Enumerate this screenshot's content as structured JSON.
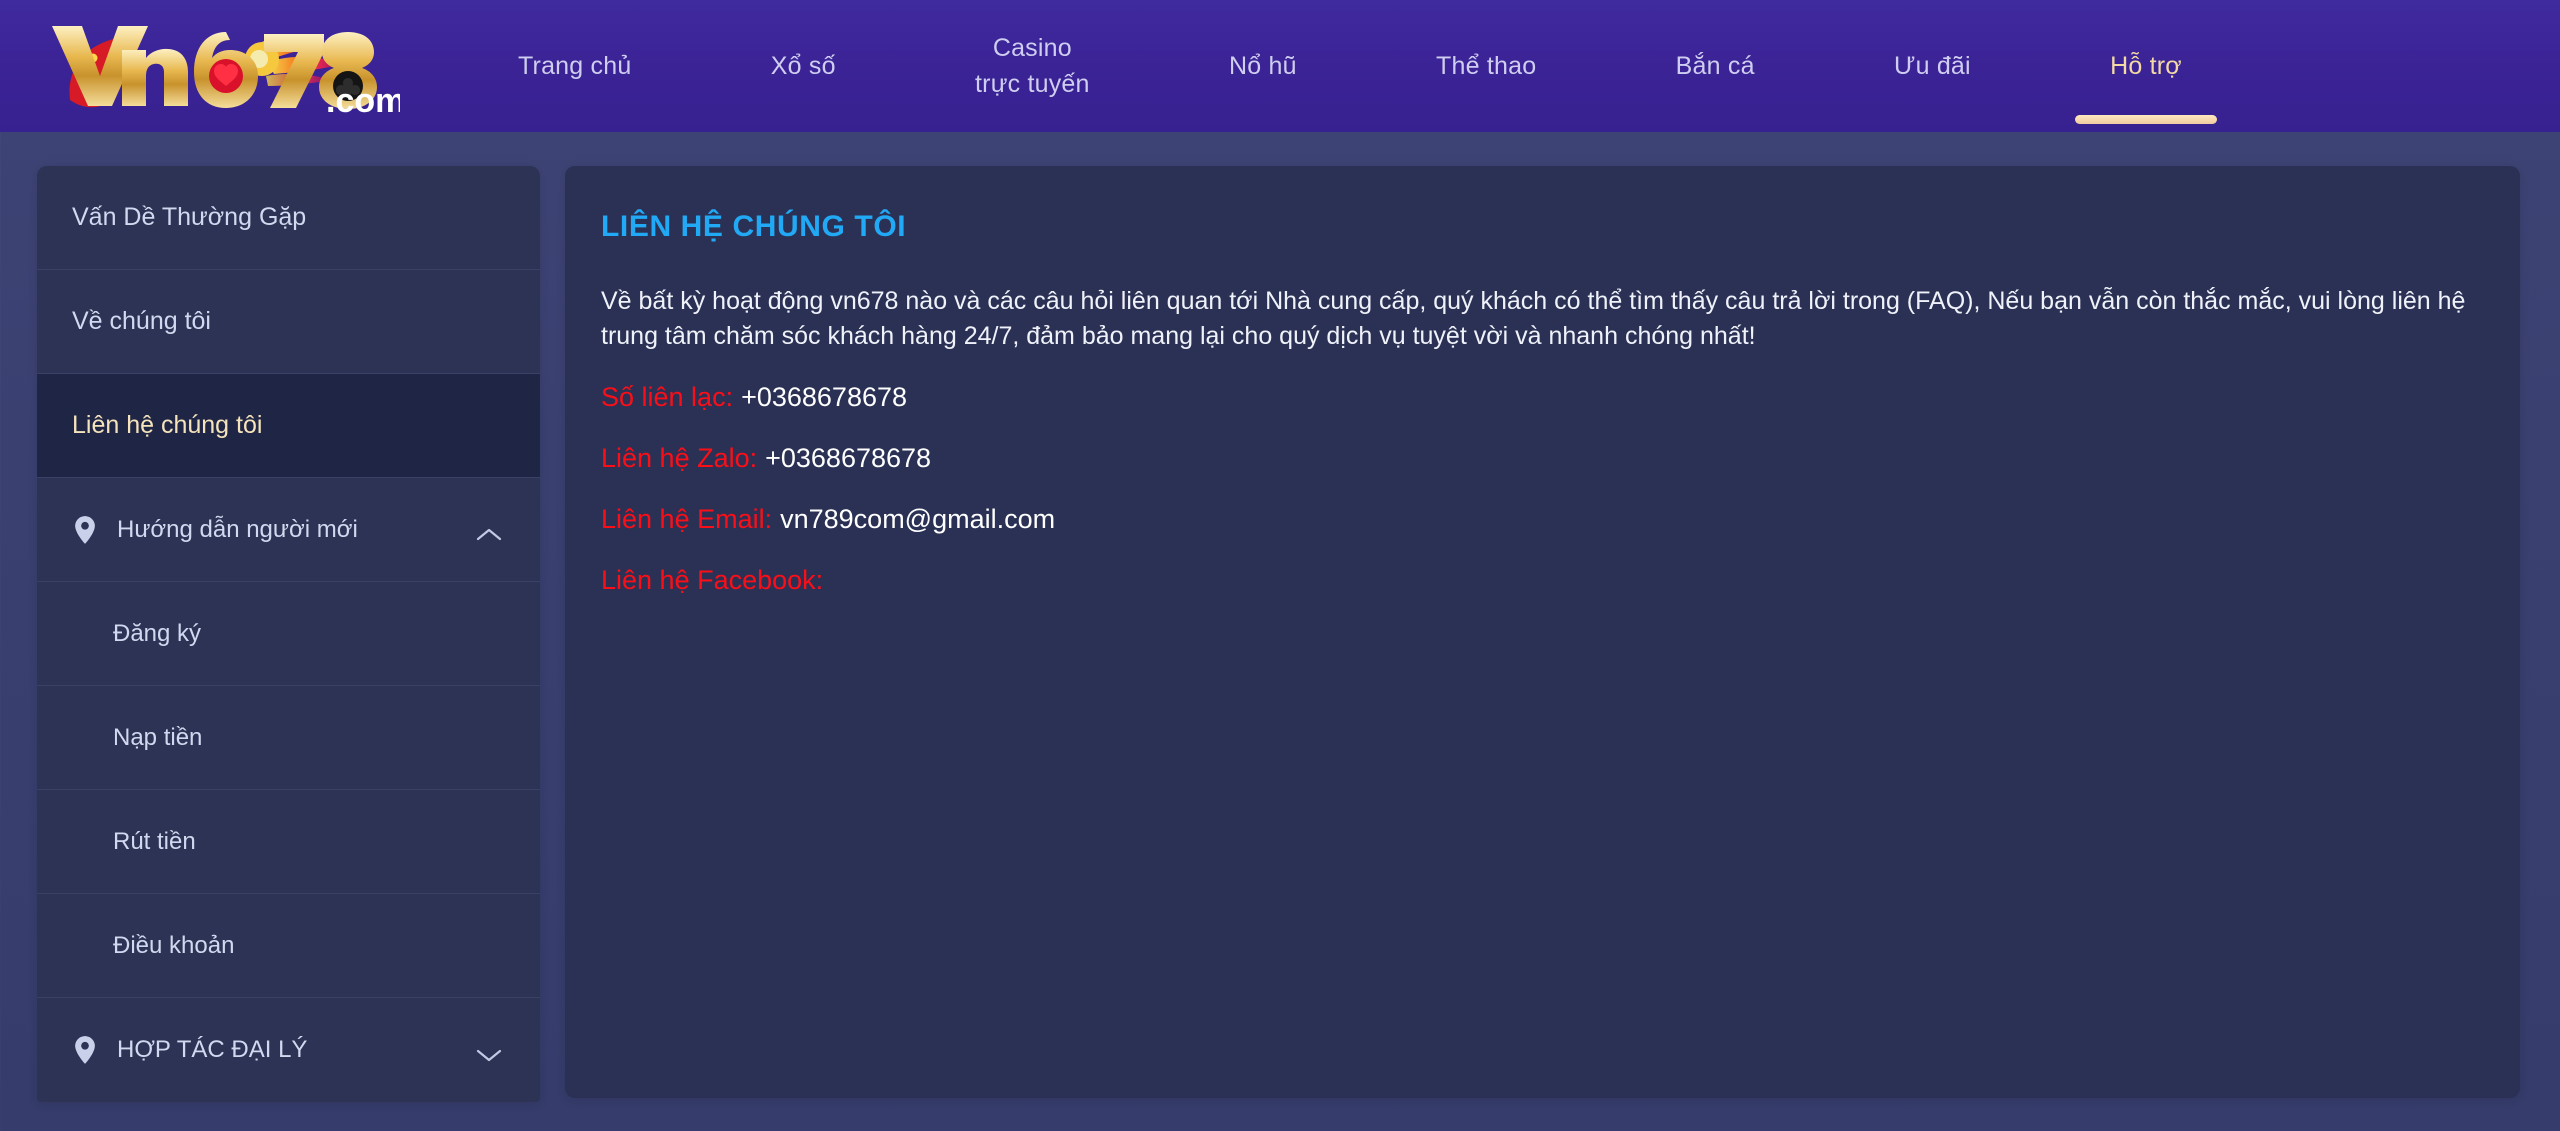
{
  "brand": {
    "logo_text": "vn678",
    "logo_suffix": ".com",
    "logo_name": "vn678.com"
  },
  "colors": {
    "header_bg": "#3b2396",
    "page_bg": "#3b4270",
    "panel_bg": "#2a3154",
    "sidebar_bg": "#2c3355",
    "sidebar_active_bg": "#1f2544",
    "accent_gold": "#f3d9a4",
    "title_blue": "#22a9f5",
    "label_red": "#fa0f19",
    "value_white": "#ffffff"
  },
  "nav": {
    "items": [
      {
        "label": "Trang chủ",
        "active": false
      },
      {
        "label": "Xổ số",
        "active": false
      },
      {
        "label": "Casino\ntrực tuyến",
        "active": false
      },
      {
        "label": "Nổ hũ",
        "active": false
      },
      {
        "label": "Thể thao",
        "active": false
      },
      {
        "label": "Bắn cá",
        "active": false
      },
      {
        "label": "Ưu đãi",
        "active": false
      },
      {
        "label": "Hỗ trợ",
        "active": true
      }
    ]
  },
  "sidebar": {
    "items": [
      {
        "label": "Vấn Dề Thường Gặp",
        "type": "link",
        "active": false
      },
      {
        "label": "Về chúng tôi",
        "type": "link",
        "active": false
      },
      {
        "label": "Liên hệ chúng tôi",
        "type": "link",
        "active": true
      },
      {
        "label": "Hướng dẫn người mới",
        "type": "group",
        "expanded": true,
        "icon": "location-pin-icon",
        "chevron": "chevron-up-icon"
      },
      {
        "label": "Đăng ký",
        "type": "sub",
        "active": false
      },
      {
        "label": "Nạp tiền",
        "type": "sub",
        "active": false
      },
      {
        "label": "Rút tiền",
        "type": "sub",
        "active": false
      },
      {
        "label": "Điều khoản",
        "type": "sub",
        "active": false
      },
      {
        "label": "HỢP TÁC ĐẠI LÝ",
        "type": "group",
        "expanded": false,
        "icon": "location-pin-icon",
        "chevron": "chevron-down-icon"
      }
    ]
  },
  "main": {
    "title": "LIÊN HỆ CHÚNG TÔI",
    "intro": "Về bất kỳ hoạt động vn678 nào và các câu hỏi liên quan tới Nhà cung cấp, quý khách có thể tìm thấy câu trả lời trong (FAQ), Nếu bạn vẫn còn thắc mắc, vui lòng liên hệ trung tâm chăm sóc khách hàng 24/7, đảm bảo mang lại cho quý dịch vụ tuyệt vời và nhanh chóng nhất!",
    "contacts": [
      {
        "label": "Số liên lạc:",
        "value": "+0368678678"
      },
      {
        "label": "Liên hệ Zalo:",
        "value": "+0368678678"
      },
      {
        "label": "Liên hệ Email:",
        "value": "vn789com@gmail.com"
      },
      {
        "label": "Liên hệ Facebook:",
        "value": ""
      }
    ]
  }
}
